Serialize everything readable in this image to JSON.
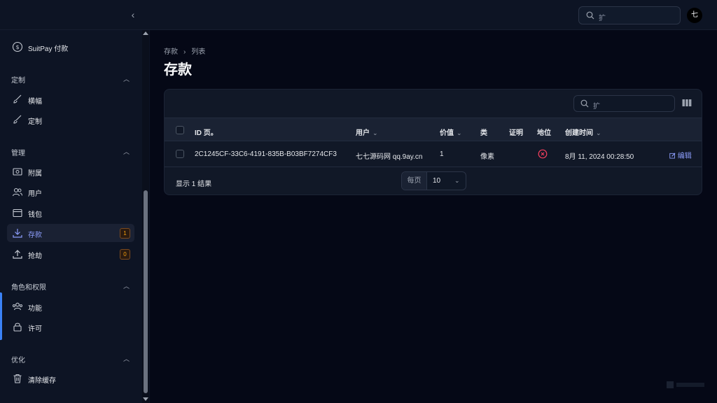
{
  "topbar": {
    "collapse_icon": "chevron-left-icon",
    "search_placeholder": "扩",
    "avatar_initial": "七"
  },
  "sidebar": {
    "items_top": [
      {
        "label": "SuitPay 付款",
        "icon": "dollar-circle-icon"
      }
    ],
    "groups": [
      {
        "label": "定制",
        "items": [
          {
            "label": "横幅",
            "icon": "brush-icon"
          },
          {
            "label": "定制",
            "icon": "brush-icon"
          }
        ]
      },
      {
        "label": "管理",
        "items": [
          {
            "label": "附属",
            "icon": "id-card-icon"
          },
          {
            "label": "用户",
            "icon": "users-icon"
          },
          {
            "label": "钱包",
            "icon": "wallet-icon"
          },
          {
            "label": "存款",
            "icon": "download-icon",
            "badge": "1",
            "active": true
          },
          {
            "label": "抢劫",
            "icon": "upload-icon",
            "badge": "0"
          }
        ]
      },
      {
        "label": "角色和权限",
        "items": [
          {
            "label": "功能",
            "icon": "user-group-icon"
          },
          {
            "label": "许可",
            "icon": "lock-icon"
          }
        ]
      },
      {
        "label": "优化",
        "items": [
          {
            "label": "清除缓存",
            "icon": "trash-icon"
          }
        ]
      }
    ]
  },
  "main": {
    "breadcrumb": [
      "存款",
      "列表"
    ],
    "title": "存款",
    "table": {
      "search_placeholder": "扩",
      "columns": [
        "ID 页。",
        "用户",
        "价值",
        "类",
        "证明",
        "地位",
        "创建时间"
      ],
      "rows": [
        {
          "id": "2C1245CF-33C6-4191-835B-B03BF7274CF3",
          "user": "七七源码网 qq.9ay.cn",
          "value": "1",
          "type": "像素",
          "proof": "",
          "status": "x-circle-icon",
          "created": "8月 11, 2024 00:28:50",
          "action": "编辑"
        }
      ],
      "footer_text": "显示 1 结果",
      "per_page_label": "每页",
      "per_page_value": "10"
    }
  },
  "colors": {
    "accent": "#8b9cf9",
    "badge": "#f59e0b",
    "danger": "#f43f5e",
    "bg": "#050816"
  }
}
